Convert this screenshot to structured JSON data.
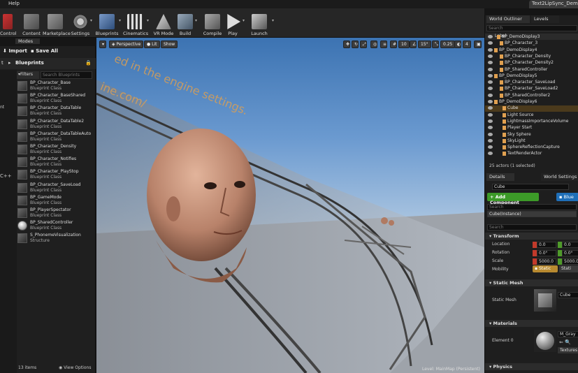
{
  "menubar": {
    "help": "Help",
    "document_title": "Text2LipSync_Dem"
  },
  "toolbar": {
    "items": [
      "Control",
      "Content",
      "Marketplace",
      "Settings",
      "Blueprints",
      "Cinematics",
      "VR Mode",
      "Build",
      "Compile",
      "Play",
      "Launch"
    ]
  },
  "modes": {
    "tab": "Modes"
  },
  "content_browser": {
    "import": "Import",
    "save_all": "Save All",
    "path": "Blueprints",
    "filters": "Filters",
    "search_placeholder": "Search Blueprints",
    "left_labels": [
      "nt",
      "t",
      "C++"
    ],
    "assets": [
      {
        "name": "BP_Character_Base",
        "type": "Blueprint Class"
      },
      {
        "name": "BP_Character_BaseShared",
        "type": "Blueprint Class"
      },
      {
        "name": "BP_Character_DataTable",
        "type": "Blueprint Class"
      },
      {
        "name": "BP_Character_DataTable2",
        "type": "Blueprint Class"
      },
      {
        "name": "BP_Character_DataTableAuto",
        "type": "Blueprint Class"
      },
      {
        "name": "BP_Character_Density",
        "type": "Blueprint Class"
      },
      {
        "name": "BP_Character_Notifies",
        "type": "Blueprint Class"
      },
      {
        "name": "BP_Character_PlayStop",
        "type": "Blueprint Class"
      },
      {
        "name": "BP_Character_SaveLoad",
        "type": "Blueprint Class"
      },
      {
        "name": "BP_GameMode",
        "type": "Blueprint Class"
      },
      {
        "name": "BP_PlayerSpectator",
        "type": "Blueprint Class"
      },
      {
        "name": "BP_SharedController",
        "type": "Blueprint Class"
      },
      {
        "name": "S_PhonemeVisualization",
        "type": "Structure"
      }
    ],
    "item_count": "13 items",
    "view_options": "View Options"
  },
  "viewport": {
    "perspective": "Perspective",
    "lit": "Lit",
    "show": "Show",
    "snap_grid": "10",
    "snap_rot": "15°",
    "snap_scale": "0.25",
    "cam_speed": "4",
    "bg_text1": "ed in the engine settings.",
    "bg_text2": "ine.com/",
    "level_text": "Level: MainMap (Persistent)"
  },
  "world_outliner": {
    "tab": "World Outliner",
    "levels_tab": "Levels",
    "search_placeholder": "Search",
    "col_label": "Label",
    "rows": [
      "BP_DemoDisplay3",
      "BP_Character_3",
      "BP_DemoDisplay4",
      "BP_Character_Density",
      "BP_Character_Density2",
      "BP_SharedController",
      "BP_DemoDisplay5",
      "BP_Character_SaveLoad",
      "BP_Character_SaveLoad2",
      "BP_SharedController2",
      "BP_DemoDisplay6",
      "Cube",
      "Light Source",
      "LightmassImportanceVolume",
      "Player Start",
      "Sky Sphere",
      "SkyLight",
      "SphereReflectionCapture",
      "TextRenderActor"
    ],
    "count": "25 actors (1 selected)"
  },
  "details": {
    "tab": "Details",
    "world_settings_tab": "World Settings",
    "name": "Cube",
    "add_component": "+ Add Component",
    "blueprint_btn": "Blue",
    "search_placeholder": "Search",
    "instance": "Cube(Instance)",
    "search2_placeholder": "Search",
    "transform": "Transform",
    "location": "Location",
    "rotation": "Rotation",
    "scale": "Scale",
    "loc_x": "0.0",
    "loc_y": "0.0",
    "rot_x": "0.0°",
    "rot_y": "0.0°",
    "scale_x": "5000.0",
    "scale_y": "5000.0",
    "mobility": "Mobility",
    "static": "Static",
    "static2": "Stati",
    "static_mesh_section": "Static Mesh",
    "static_mesh_label": "Static Mesh",
    "mesh_name": "Cube",
    "materials_section": "Materials",
    "element0": "Element 0",
    "material_name": "M_Gray",
    "textures": "Textures",
    "physics_section": "Physics"
  },
  "colors": {
    "accent": "#e0a050",
    "add_component": "#3c9a28",
    "blueprint": "#1f6fb8"
  }
}
